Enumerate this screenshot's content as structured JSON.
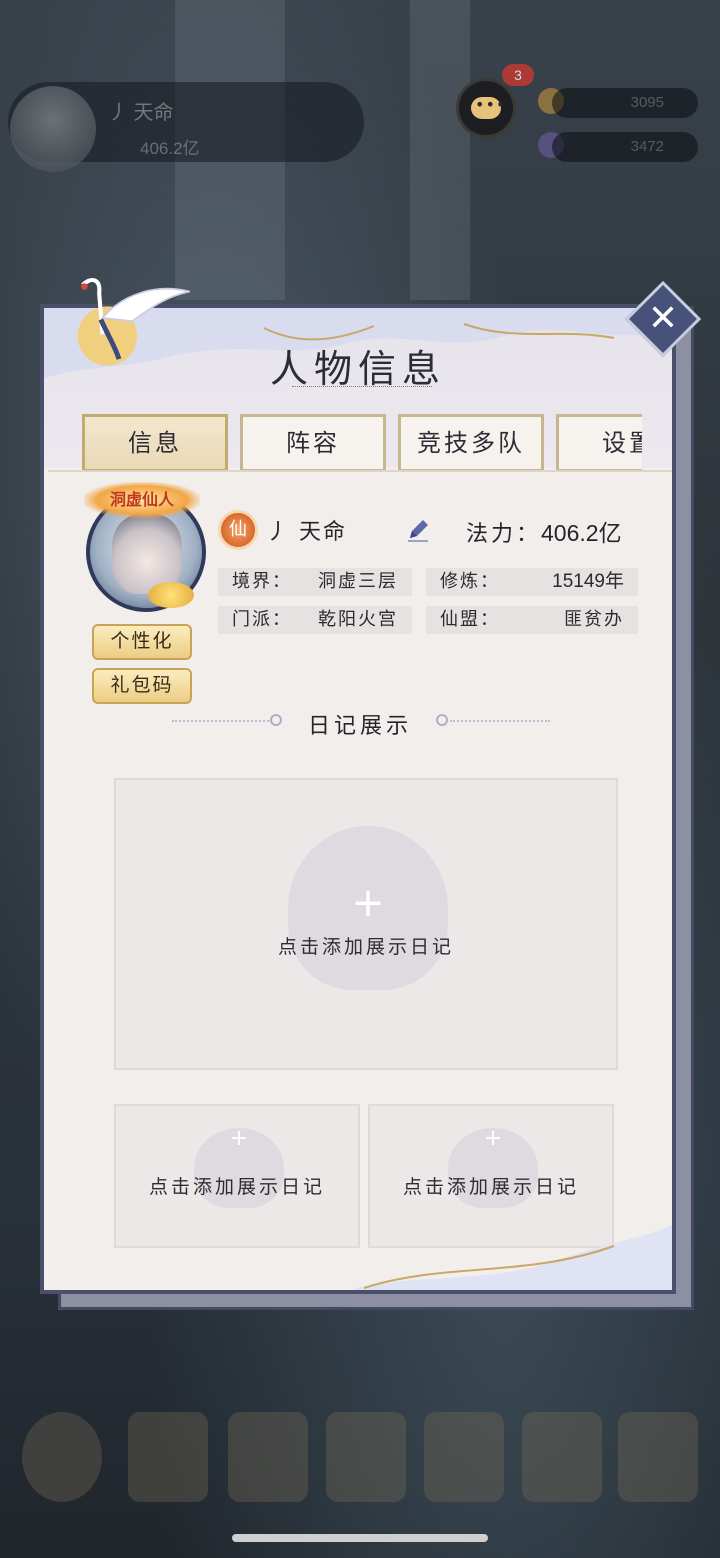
{
  "background": {
    "player_name": "丿 天命",
    "player_power": "406.2亿",
    "chat_badge": "3",
    "resource_1": "3095",
    "resource_2": "3472"
  },
  "modal": {
    "title": "人物信息",
    "close_label": "✕",
    "tabs": [
      {
        "label": "信息",
        "active": true
      },
      {
        "label": "阵容",
        "active": false
      },
      {
        "label": "竞技多队",
        "active": false
      },
      {
        "label": "设置",
        "active": false
      }
    ],
    "profile": {
      "avatar_title": "洞虚仙人",
      "class_badge": "仙",
      "name": "丿 天命",
      "power_label": "法力：",
      "power_value": "406.2亿",
      "personalize_button": "个性化",
      "giftcode_button": "礼包码",
      "stats": [
        {
          "key": "境界：",
          "value": "洞虚三层"
        },
        {
          "key": "修炼：",
          "value": "15149年"
        },
        {
          "key": "门派：",
          "value": "乾阳火宫"
        },
        {
          "key": "仙盟：",
          "value": "匪贫办"
        }
      ]
    },
    "diary": {
      "section_title": "日记展示",
      "cards": [
        {
          "label": "点击添加展示日记"
        },
        {
          "label": "点击添加展示日记"
        },
        {
          "label": "点击添加展示日记"
        }
      ]
    }
  },
  "colors": {
    "panel_bg": "#f3efed",
    "panel_border": "#4a4f6c",
    "tab_active": "#ead9b4",
    "close_button": "#47527a",
    "badge_orange": "#d9682e"
  }
}
